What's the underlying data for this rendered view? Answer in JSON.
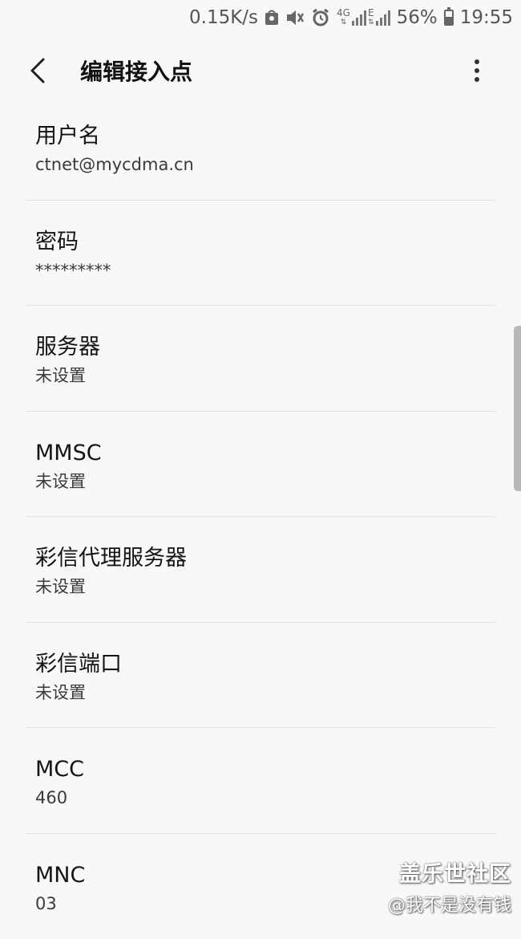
{
  "status_bar": {
    "net_speed": "0.15K/s",
    "network_label": "4G",
    "network_label_2": "E",
    "battery_percent": "56%",
    "battery_level": 0.56,
    "time": "19:55",
    "icons": [
      "app-notification-icon",
      "mute-icon",
      "alarm-icon",
      "signal-icon",
      "battery-icon"
    ]
  },
  "appbar": {
    "title": "编辑接入点"
  },
  "items": [
    {
      "label": "用户名",
      "value": "ctnet@mycdma.cn"
    },
    {
      "label": "密码",
      "value": "*********"
    },
    {
      "label": "服务器",
      "value": "未设置"
    },
    {
      "label": "MMSC",
      "value": "未设置"
    },
    {
      "label": "彩信代理服务器",
      "value": "未设置"
    },
    {
      "label": "彩信端口",
      "value": "未设置"
    },
    {
      "label": "MCC",
      "value": "460"
    },
    {
      "label": "MNC",
      "value": "03"
    }
  ],
  "watermark": {
    "title": "盖乐世社区",
    "author": "@我不是没有钱"
  }
}
